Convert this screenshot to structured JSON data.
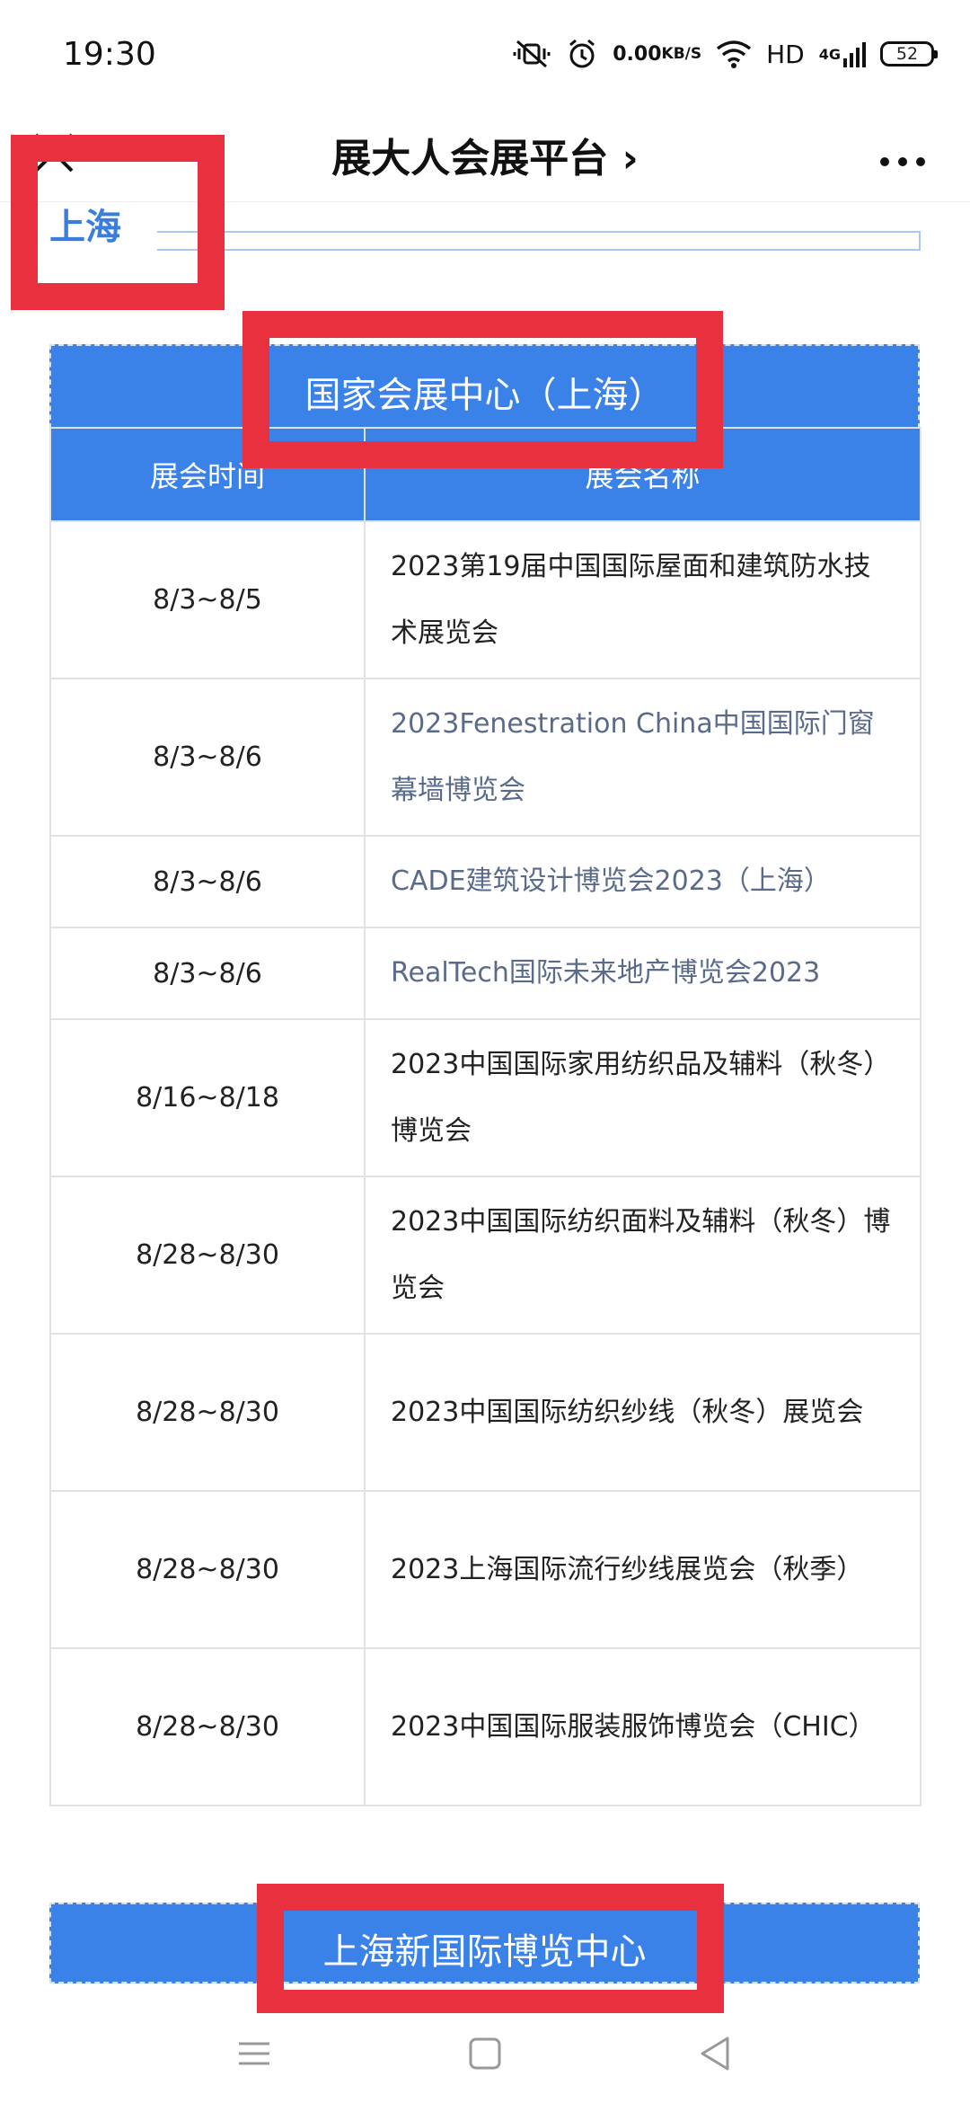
{
  "status_bar": {
    "time": "19:30",
    "net_speed_value": "0.00",
    "net_speed_unit": "KB/S",
    "hd": "HD",
    "signal": "4G",
    "battery": "52"
  },
  "header": {
    "title": "展大人会展平台 ›"
  },
  "city": "上海",
  "venue_1": "国家会展中心（上海）",
  "venue_2": "上海新国际博览中心",
  "table": {
    "col_date": "展会时间",
    "col_name": "展会名称",
    "rows": [
      {
        "date": "8/3~8/5",
        "name": "2023第19届中国国际屋面和建筑防水技术展览会"
      },
      {
        "date": "8/3~8/6",
        "name": "2023Fenestration China中国国际门窗幕墙博览会"
      },
      {
        "date": "8/3~8/6",
        "name": "CADE建筑设计博览会2023（上海）"
      },
      {
        "date": "8/3~8/6",
        "name": "RealTech国际未来地产博览会2023"
      },
      {
        "date": "8/16~8/18",
        "name": "2023中国国际家用纺织品及辅料（秋冬）博览会"
      },
      {
        "date": "8/28~8/30",
        "name": "2023中国国际纺织面料及辅料（秋冬）博览会"
      },
      {
        "date": "8/28~8/30",
        "name": "2023中国国际纺织纱线（秋冬）展览会"
      },
      {
        "date": "8/28~8/30",
        "name": "2023上海国际流行纱线展览会（秋季）"
      },
      {
        "date": "8/28~8/30",
        "name": "2023中国国际服装服饰博览会（CHIC）"
      }
    ]
  }
}
